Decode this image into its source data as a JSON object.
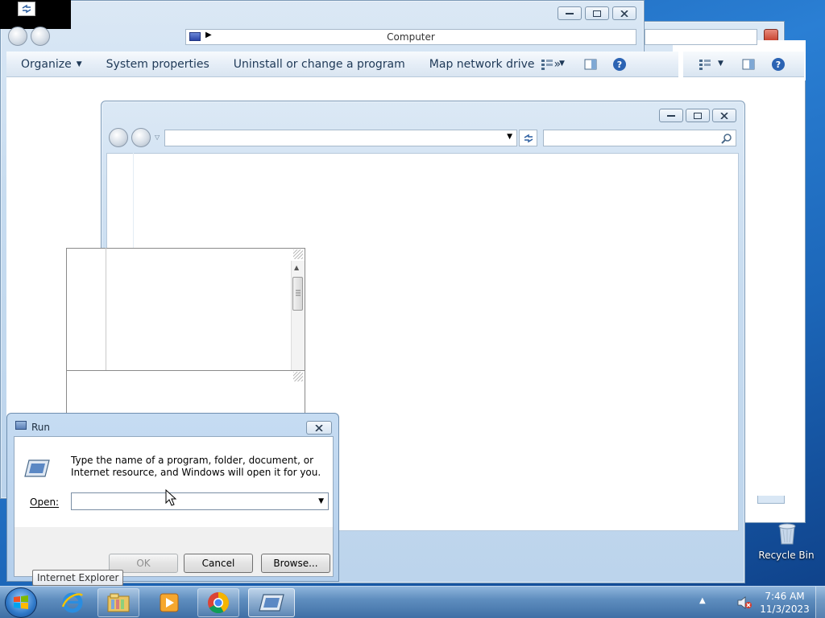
{
  "explorer": {
    "address": "Computer",
    "commands": {
      "organize": "Organize",
      "system_properties": "System properties",
      "uninstall": "Uninstall or change a program",
      "map_drive": "Map network drive",
      "more": "»"
    }
  },
  "run_dialog": {
    "title": "Run",
    "description": "Type the name of a program, folder, document, or Internet resource, and Windows will open it for you.",
    "open_label": "Open:",
    "open_value": "",
    "ok": "OK",
    "cancel": "Cancel",
    "browse": "Browse..."
  },
  "tooltip": "Internet Explorer",
  "desktop": {
    "recycle_bin": "Recycle Bin"
  },
  "clock": {
    "time": "7:46 AM",
    "date": "11/3/2023"
  },
  "icons": {
    "start": "windows-orb-icon",
    "ie": "internet-explorer-icon",
    "explorer": "folder-library-icon",
    "media": "media-player-icon",
    "chrome": "chrome-icon",
    "run": "run-icon",
    "volume": "speaker-muted-icon"
  },
  "colors": {
    "accent": "#1c66b8",
    "taskbar": "#5f8ebf"
  }
}
